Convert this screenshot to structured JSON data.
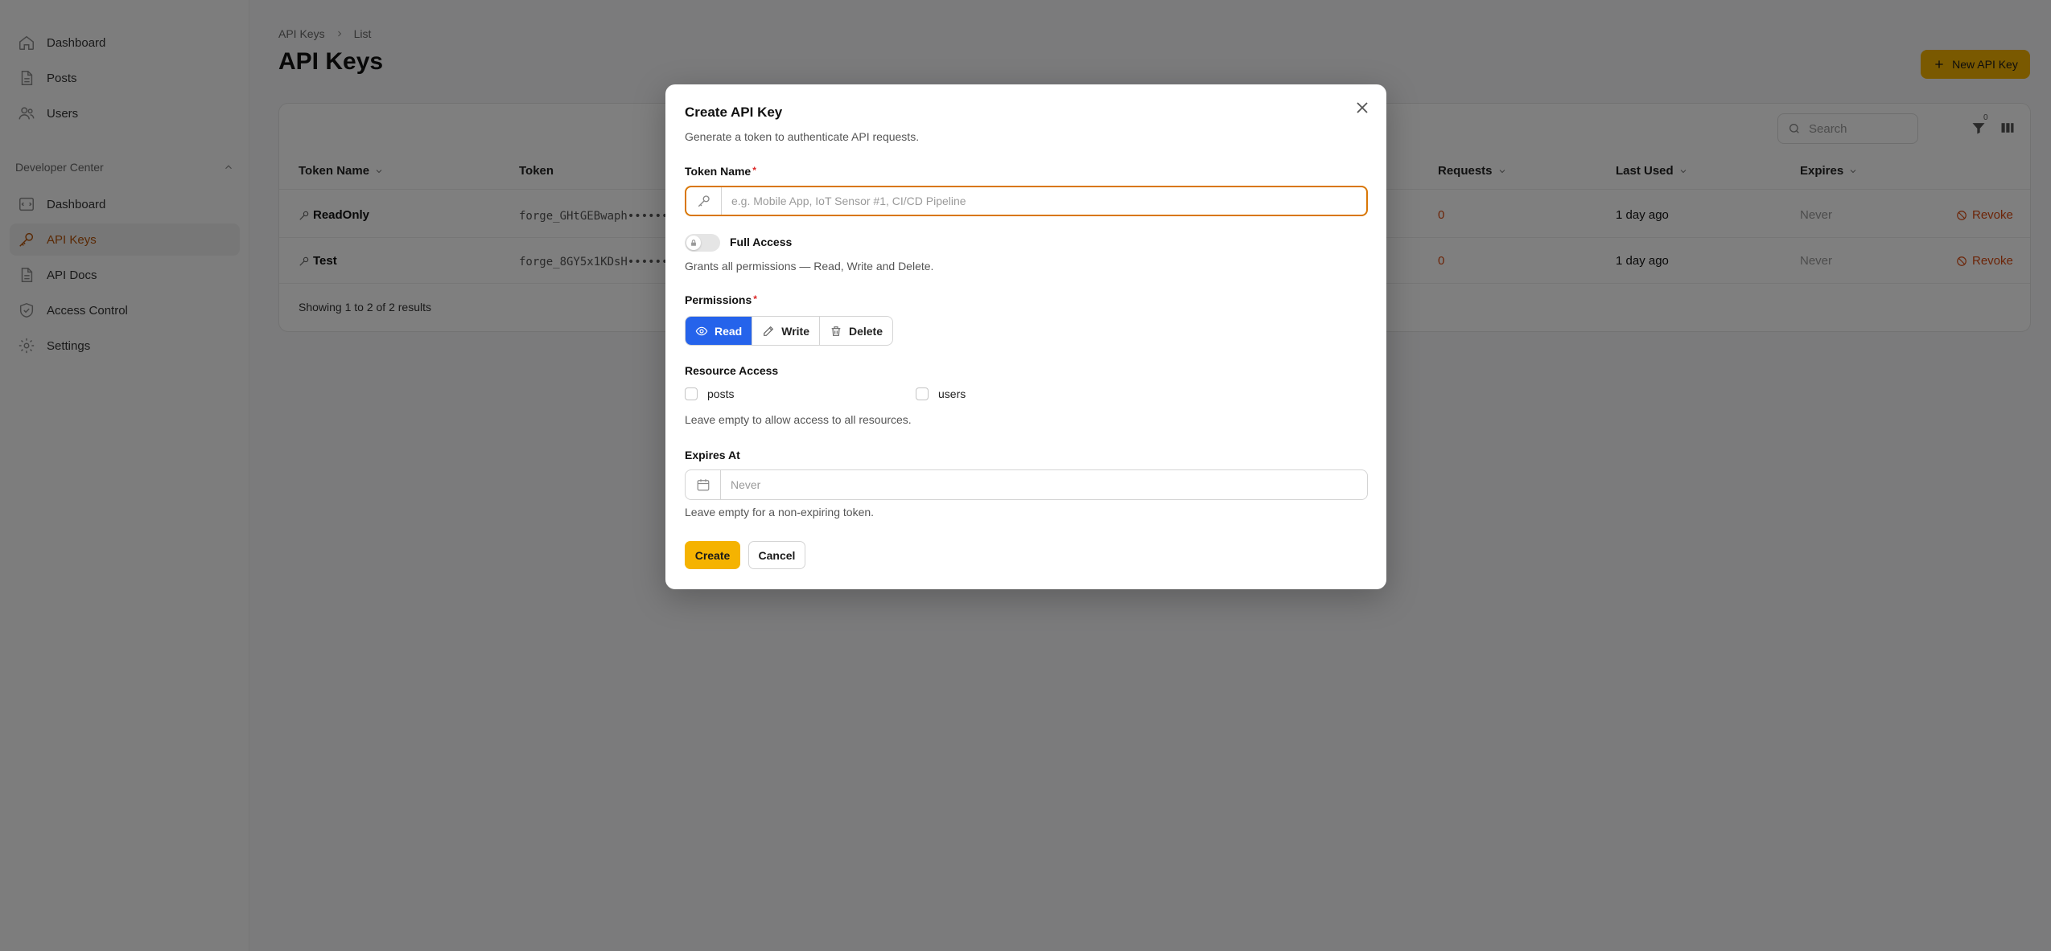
{
  "sidebar": {
    "items": [
      {
        "label": "Dashboard",
        "icon": "home-icon"
      },
      {
        "label": "Posts",
        "icon": "document-icon"
      },
      {
        "label": "Users",
        "icon": "users-icon"
      }
    ],
    "group_label": "Developer Center",
    "group_items": [
      {
        "label": "Dashboard",
        "icon": "dashboard-icon"
      },
      {
        "label": "API Keys",
        "icon": "key-icon",
        "active": true
      },
      {
        "label": "API Docs",
        "icon": "document-icon"
      },
      {
        "label": "Access Control",
        "icon": "shield-icon"
      },
      {
        "label": "Settings",
        "icon": "gear-icon"
      }
    ]
  },
  "header": {
    "breadcrumb": [
      "API Keys",
      "List"
    ],
    "title": "API Keys",
    "new_button": "New API Key",
    "filter_count": "0"
  },
  "table": {
    "search_placeholder": "Search",
    "columns": [
      "Token Name",
      "Token",
      "Requests",
      "Last Used",
      "Expires"
    ],
    "rows": [
      {
        "name": "ReadOnly",
        "token": "forge_GHtGEBwaph••••••",
        "requests": "0",
        "last_used": "1 day ago",
        "expires": "Never",
        "action": "Revoke"
      },
      {
        "name": "Test",
        "token": "forge_8GY5x1KDsH••••••",
        "requests": "0",
        "last_used": "1 day ago",
        "expires": "Never",
        "action": "Revoke"
      }
    ],
    "footer": "Showing 1 to 2 of 2 results"
  },
  "modal": {
    "title": "Create API Key",
    "description": "Generate a token to authenticate API requests.",
    "token_name_label": "Token Name",
    "token_name_placeholder": "e.g. Mobile App, IoT Sensor #1, CI/CD Pipeline",
    "token_name_value": "",
    "full_access_label": "Full Access",
    "full_access_on": false,
    "full_access_hint": "Grants all permissions — Read, Write and Delete.",
    "permissions_label": "Permissions",
    "permissions": [
      {
        "label": "Read",
        "selected": true
      },
      {
        "label": "Write",
        "selected": false
      },
      {
        "label": "Delete",
        "selected": false
      }
    ],
    "resource_label": "Resource Access",
    "resources": [
      {
        "label": "posts",
        "checked": false
      },
      {
        "label": "users",
        "checked": false
      }
    ],
    "resource_hint": "Leave empty to allow access to all resources.",
    "expires_label": "Expires At",
    "expires_placeholder": "Never",
    "expires_hint": "Leave empty for a non-expiring token.",
    "create_button": "Create",
    "cancel_button": "Cancel"
  },
  "colors": {
    "accent": "#f5b301",
    "focus": "#d97706",
    "active_nav": "#b45309",
    "danger": "#d9480f",
    "primary_blue": "#2563eb"
  }
}
